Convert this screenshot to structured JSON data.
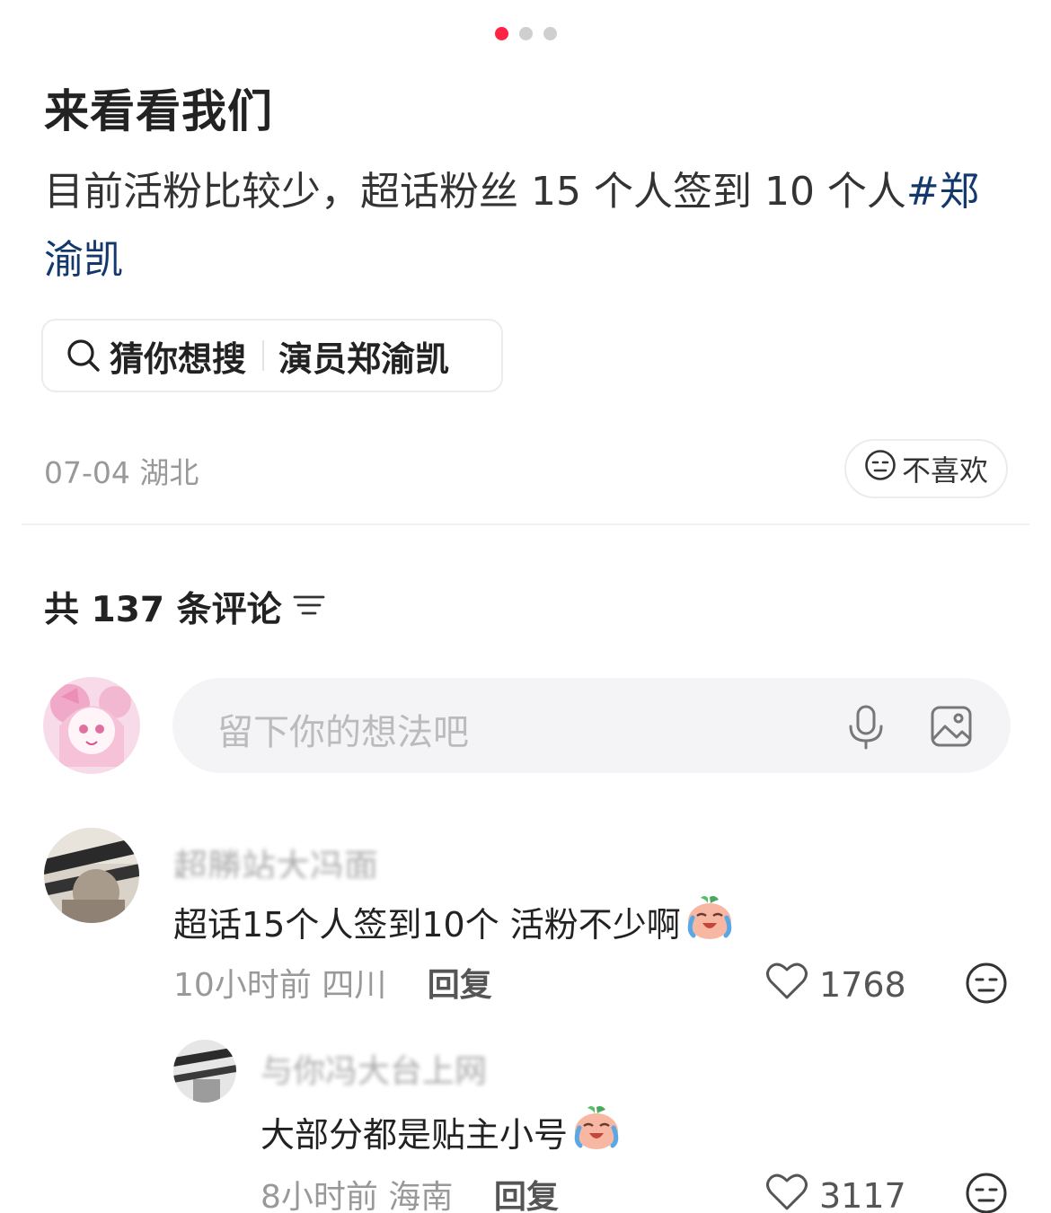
{
  "carousel": {
    "total": 3,
    "active": 0,
    "active_color": "#ff2442"
  },
  "post": {
    "title": "来看看我们",
    "body": "目前活粉比较少，超话粉丝 15 个人签到 10 个人",
    "hashtag": "#郑渝凯",
    "hashtag_color": "#13386c"
  },
  "search_suggest": {
    "icon": "search-icon",
    "prefix": "猜你想搜",
    "query": "演员郑渝凯"
  },
  "post_meta": {
    "date": "07-04",
    "location": "湖北"
  },
  "dislike": {
    "icon": "neutral-face-icon",
    "label": "不喜欢"
  },
  "comments_header": {
    "label": "共 137 条评论",
    "icon": "filter-icon"
  },
  "comment_input": {
    "placeholder": "留下你的想法吧",
    "icons": [
      "mic-icon",
      "image-icon"
    ]
  },
  "comments": [
    {
      "author": "超勝站大冯面",
      "text": "超话15个人签到10个 活粉不少啊",
      "emoji": "crying-laughing-peach-emoji",
      "time": "10小时前",
      "location": "四川",
      "reply_label": "回复",
      "likes": "1768"
    },
    {
      "author": "与你冯大台上网",
      "text": "大部分都是贴主小号",
      "emoji": "crying-laughing-peach-emoji",
      "time": "8小时前",
      "location": "海南",
      "reply_label": "回复",
      "likes": "3117"
    }
  ]
}
